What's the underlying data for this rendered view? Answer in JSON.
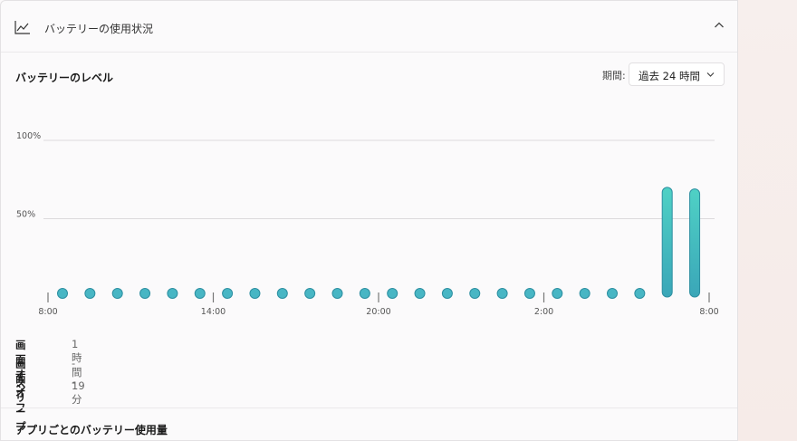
{
  "header": {
    "title": "バッテリーの使用状況",
    "icon": "line-chart-icon",
    "collapse_icon": "chevron-up-icon"
  },
  "battery_level": {
    "title": "バッテリーのレベル",
    "period_label": "期間:",
    "period_value": "過去 24 時間"
  },
  "chart_data": {
    "type": "bar",
    "title": "",
    "xlabel": "",
    "ylabel": "",
    "ylim": [
      0,
      100
    ],
    "y_ticks": [
      "100%",
      "50%"
    ],
    "x_ticks": [
      "8:00",
      "14:00",
      "20:00",
      "2:00",
      "8:00"
    ],
    "values": [
      0,
      0,
      0,
      0,
      0,
      0,
      0,
      0,
      0,
      0,
      0,
      0,
      0,
      0,
      0,
      0,
      0,
      0,
      0,
      0,
      0,
      0,
      70,
      69
    ],
    "bar_color": "#3aa6b8",
    "bar_highlight": "#4fd1c5",
    "grid": true
  },
  "usage": {
    "rows": [
      {
        "label": "画面オン",
        "value": "1 時間 19 分"
      },
      {
        "label": "画面オフ",
        "value": "-"
      },
      {
        "label": "スリープ",
        "value": "-"
      }
    ]
  },
  "apps": {
    "title": "アプリごとのバッテリー使用量"
  }
}
